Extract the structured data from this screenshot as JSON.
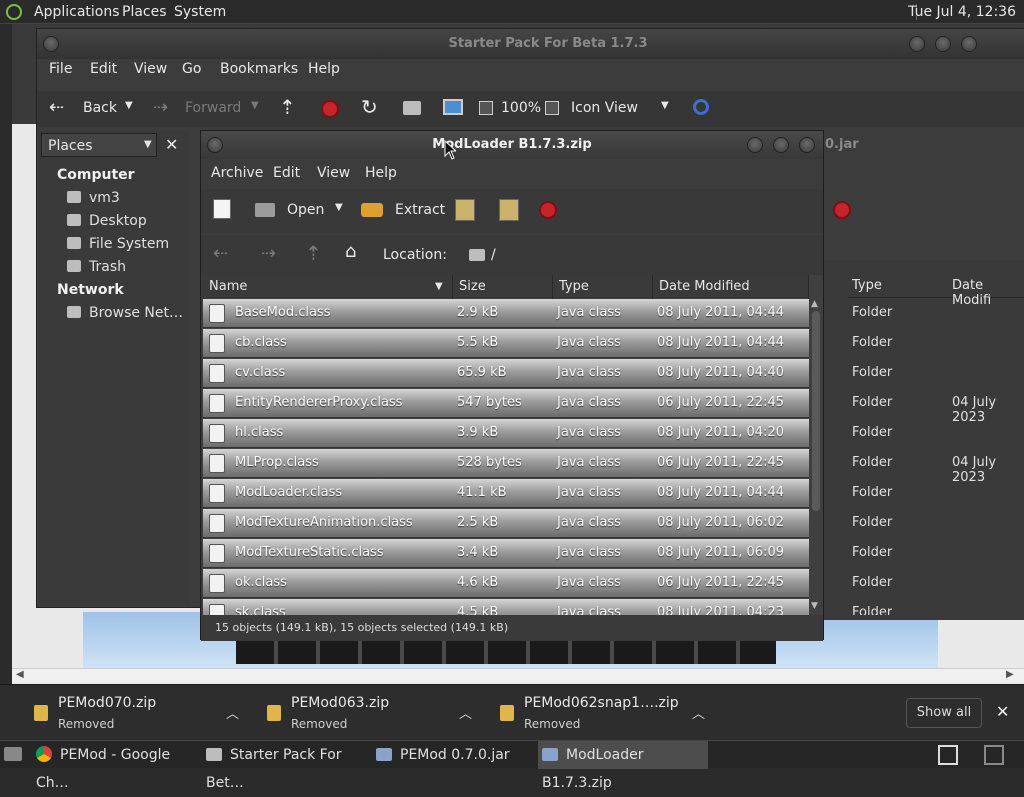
{
  "topbar": {
    "menus": [
      "Applications",
      "Places",
      "System"
    ],
    "clock": "Tue Jul  4, 12:36"
  },
  "nautilus": {
    "title": "Starter Pack For Beta 1.7.3",
    "menu": [
      "File",
      "Edit",
      "View",
      "Go",
      "Bookmarks",
      "Help"
    ],
    "toolbar": {
      "back": "Back",
      "forward": "Forward",
      "zoom": "100%",
      "view_mode": "Icon View"
    },
    "places": {
      "header": "Places",
      "computer_header": "Computer",
      "items": [
        "vm3",
        "Desktop",
        "File System",
        "Trash"
      ],
      "network_header": "Network",
      "network_items": [
        "Browse Net…"
      ]
    },
    "right_pane": {
      "background_tab": "0.jar",
      "columns": [
        "Type",
        "Date Modifi"
      ],
      "rows": [
        {
          "type": "Folder",
          "date": ""
        },
        {
          "type": "Folder",
          "date": ""
        },
        {
          "type": "Folder",
          "date": ""
        },
        {
          "type": "Folder",
          "date": "04 July 2023"
        },
        {
          "type": "Folder",
          "date": ""
        },
        {
          "type": "Folder",
          "date": "04 July 2023"
        },
        {
          "type": "Folder",
          "date": ""
        },
        {
          "type": "Folder",
          "date": ""
        },
        {
          "type": "Folder",
          "date": ""
        },
        {
          "type": "Folder",
          "date": ""
        },
        {
          "type": "Folder",
          "date": ""
        }
      ]
    }
  },
  "fileroller": {
    "title": "ModLoader B1.7.3.zip",
    "menu": [
      "Archive",
      "Edit",
      "View",
      "Help"
    ],
    "toolbar": {
      "open": "Open",
      "extract": "Extract"
    },
    "location_label": "Location:",
    "location_value": "/",
    "columns": [
      "Name",
      "Size",
      "Type",
      "Date Modified"
    ],
    "files": [
      {
        "name": "BaseMod.class",
        "size": "2.9 kB",
        "type": "Java class",
        "date": "08 July 2011, 04:44"
      },
      {
        "name": "cb.class",
        "size": "5.5 kB",
        "type": "Java class",
        "date": "08 July 2011, 04:44"
      },
      {
        "name": "cv.class",
        "size": "65.9 kB",
        "type": "Java class",
        "date": "08 July 2011, 04:40"
      },
      {
        "name": "EntityRendererProxy.class",
        "size": "547 bytes",
        "type": "Java class",
        "date": "06 July 2011, 22:45"
      },
      {
        "name": "hl.class",
        "size": "3.9 kB",
        "type": "Java class",
        "date": "08 July 2011, 04:20"
      },
      {
        "name": "MLProp.class",
        "size": "528 bytes",
        "type": "Java class",
        "date": "06 July 2011, 22:45"
      },
      {
        "name": "ModLoader.class",
        "size": "41.1 kB",
        "type": "Java class",
        "date": "08 July 2011, 04:44"
      },
      {
        "name": "ModTextureAnimation.class",
        "size": "2.5 kB",
        "type": "Java class",
        "date": "08 July 2011, 06:02"
      },
      {
        "name": "ModTextureStatic.class",
        "size": "3.4 kB",
        "type": "Java class",
        "date": "08 July 2011, 06:09"
      },
      {
        "name": "ok.class",
        "size": "4.6 kB",
        "type": "Java class",
        "date": "06 July 2011, 22:45"
      },
      {
        "name": "sk.class",
        "size": "4.5 kB",
        "type": "Java class",
        "date": "08 July 2011, 04:23"
      }
    ],
    "status": "15 objects (149.1 kB), 15 objects selected (149.1 kB)"
  },
  "downloads": {
    "items": [
      {
        "name": "PEMod070.zip",
        "status": "Removed"
      },
      {
        "name": "PEMod063.zip",
        "status": "Removed"
      },
      {
        "name": "PEMod062snap1….zip",
        "status": "Removed"
      }
    ],
    "show_all": "Show all"
  },
  "taskbar": {
    "tasks": [
      "PEMod - Google Ch…",
      "Starter Pack For Bet…",
      "PEMod 0.7.0.jar",
      "ModLoader B1.7.3.zip"
    ]
  }
}
